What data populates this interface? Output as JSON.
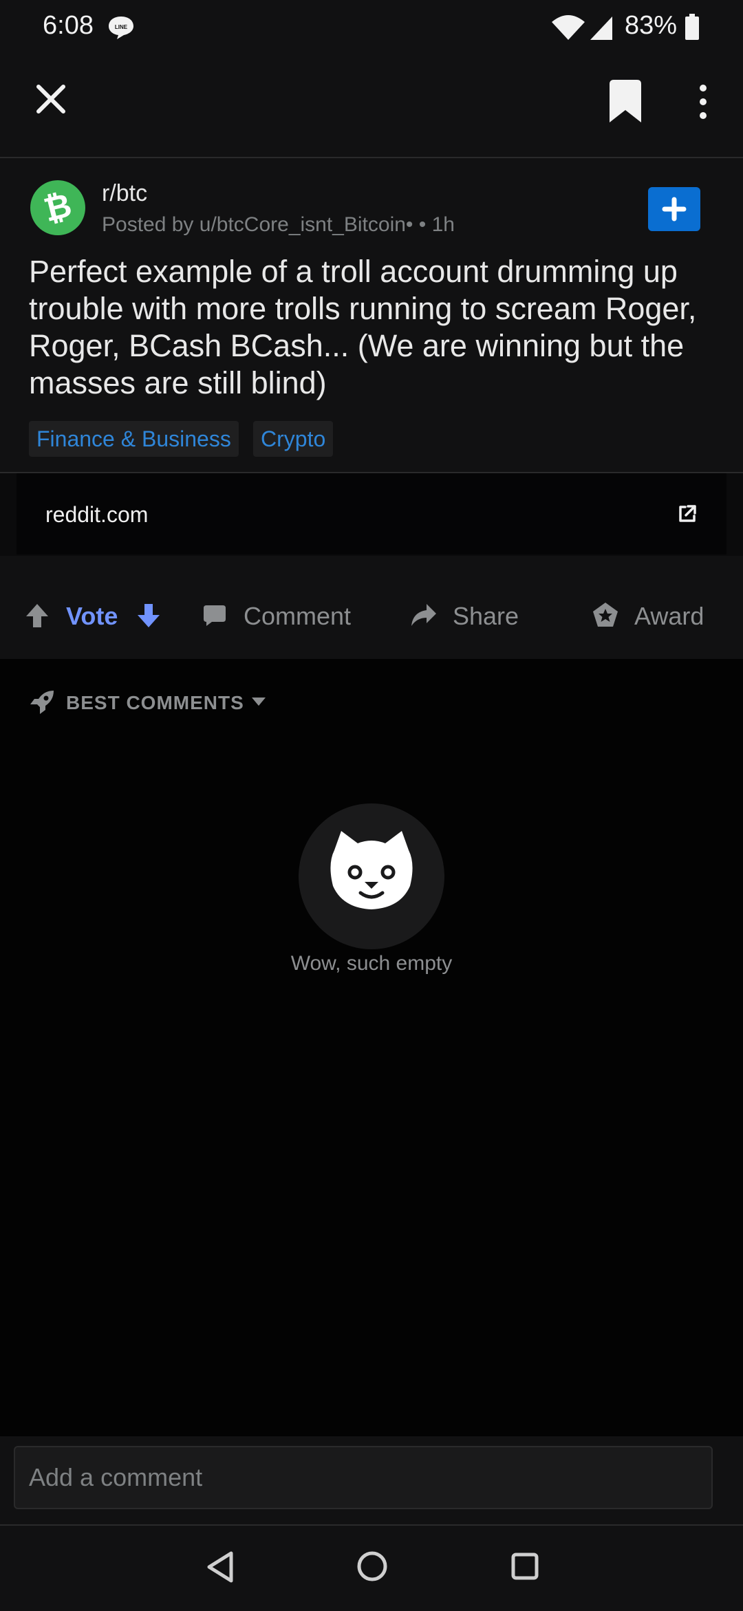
{
  "status_bar": {
    "time": "6:08",
    "battery": "83%",
    "icons": [
      "line-icon",
      "wifi-icon",
      "signal-icon",
      "battery-icon"
    ]
  },
  "header": {
    "icons": [
      "close-icon",
      "bookmark-icon",
      "more-vertical-icon"
    ]
  },
  "post": {
    "subreddit": "r/btc",
    "posted_by": "Posted by u/btcCore_isnt_Bitcoin•  • 1h",
    "title": "Perfect example of a troll account drumming up trouble with more trolls running to scream Roger, Roger, BCash BCash... (We are winning but the masses are still blind)",
    "flairs": [
      "Finance & Business",
      "Crypto"
    ],
    "link_domain": "reddit.com"
  },
  "actions": {
    "vote": "Vote",
    "comment": "Comment",
    "share": "Share",
    "award": "Award"
  },
  "comments": {
    "sort": "BEST COMMENTS",
    "empty_message": "Wow, such empty"
  },
  "comment_box": {
    "placeholder": "Add a comment"
  },
  "colors": {
    "accent_blue": "#0a6ed1",
    "vote_blue": "#7193ff",
    "avatar_green": "#3fb657",
    "background": "#030303",
    "surface": "#111112"
  }
}
